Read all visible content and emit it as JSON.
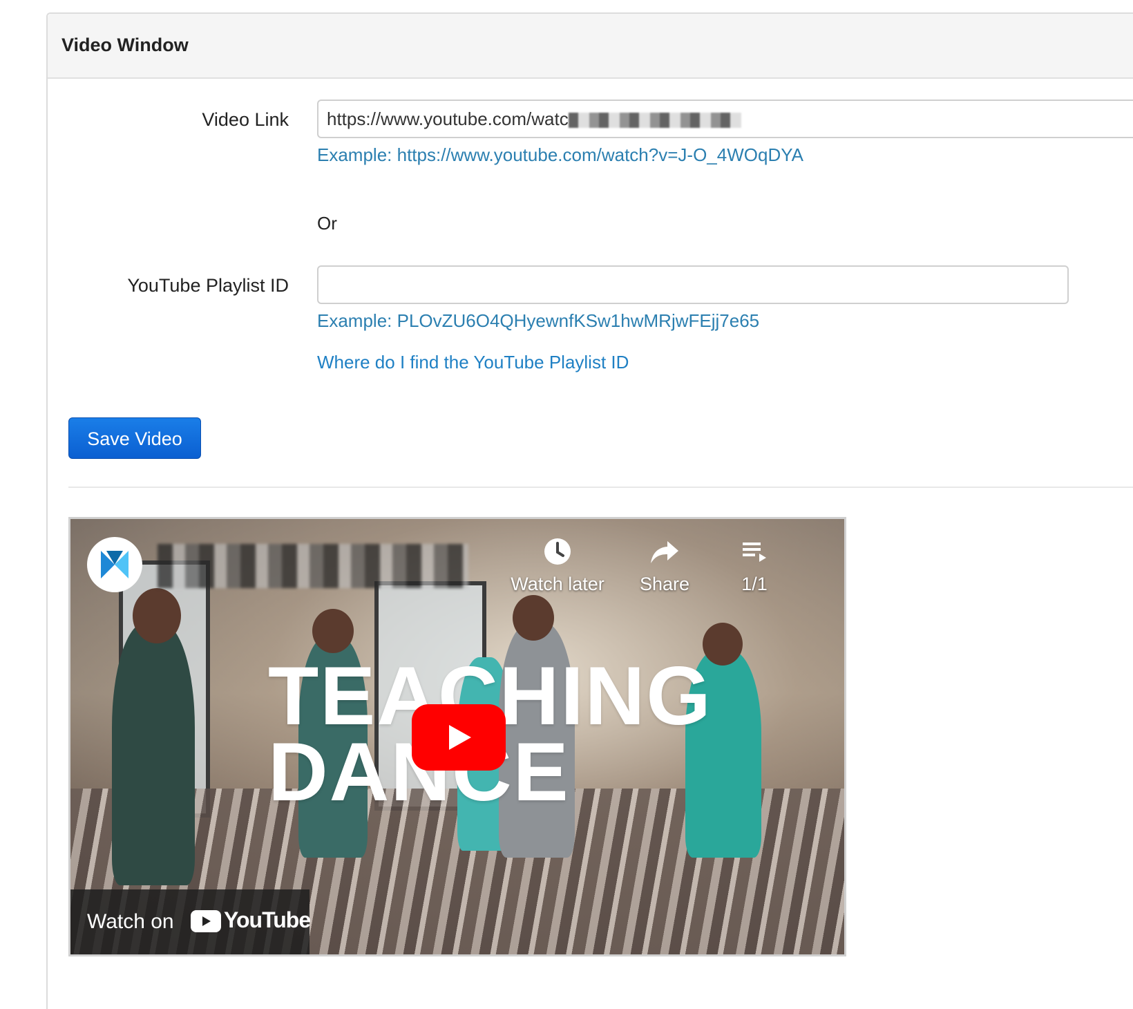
{
  "panel": {
    "title": "Video Window"
  },
  "form": {
    "video_link_label": "Video Link",
    "video_link_value": "https://www.youtube.com/watc",
    "video_link_example": "Example: https://www.youtube.com/watch?v=J-O_4WOqDYA",
    "or_text": "Or",
    "playlist_label": "YouTube Playlist ID",
    "playlist_value": "",
    "playlist_example": "Example: PLOvZU6O4QHyewnfKSw1hwMRjwFEjj7e65",
    "playlist_help_link": "Where do I find the YouTube Playlist ID",
    "save_button": "Save Video"
  },
  "video": {
    "watch_later": "Watch later",
    "share": "Share",
    "playlist_count": "1/1",
    "title_line1": "TEACHING",
    "title_line2": "DANCE",
    "watch_on": "Watch on",
    "youtube_wordmark": "YouTube",
    "icons": {
      "channel": "channel-logo-icon",
      "watch_later": "clock-icon",
      "share": "share-arrow-icon",
      "playlist": "playlist-icon",
      "play": "play-icon",
      "youtube": "youtube-logo-icon"
    }
  },
  "colors": {
    "link": "#1f80c4",
    "help": "#2b7fb0",
    "primary_button": "#0b5fd1",
    "play_button": "#ff0000"
  }
}
